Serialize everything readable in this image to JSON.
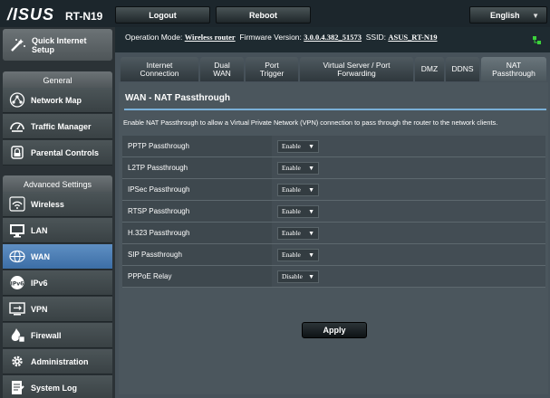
{
  "header": {
    "brand": "/ISUS",
    "model": "RT-N19",
    "logout_label": "Logout",
    "reboot_label": "Reboot",
    "language": "English"
  },
  "status_bar": {
    "operation_mode_label": "Operation Mode:",
    "operation_mode_value": "Wireless router",
    "firmware_label": "Firmware Version:",
    "firmware_value": "3.0.0.4.382_51573",
    "ssid_label": "SSID:",
    "ssid_value": "ASUS_RT-N19",
    "status_icon": "network-status-icon",
    "status_color": "#3bd13b"
  },
  "sidebar": {
    "quick_setup": {
      "label_line1": "Quick Internet",
      "label_line2": "Setup",
      "icon": "wand-icon"
    },
    "general_header": "General",
    "general_items": [
      {
        "label": "Network Map",
        "icon": "network-map-icon"
      },
      {
        "label": "Traffic Manager",
        "icon": "gauge-icon"
      },
      {
        "label": "Parental Controls",
        "icon": "lock-icon"
      }
    ],
    "advanced_header": "Advanced Settings",
    "advanced_items": [
      {
        "label": "Wireless",
        "icon": "wifi-icon"
      },
      {
        "label": "LAN",
        "icon": "monitor-icon"
      },
      {
        "label": "WAN",
        "icon": "globe-icon",
        "active": true
      },
      {
        "label": "IPv6",
        "icon": "ipv6-icon"
      },
      {
        "label": "VPN",
        "icon": "vpn-icon"
      },
      {
        "label": "Firewall",
        "icon": "firewall-icon"
      },
      {
        "label": "Administration",
        "icon": "gear-icon"
      },
      {
        "label": "System Log",
        "icon": "log-icon"
      }
    ]
  },
  "tabs": [
    {
      "line1": "Internet",
      "line2": "Connection"
    },
    {
      "line1": "Dual",
      "line2": "WAN"
    },
    {
      "line1": "Port",
      "line2": "Trigger"
    },
    {
      "line1": "Virtual Server / Port",
      "line2": "Forwarding"
    },
    {
      "line1": "DMZ",
      "line2": ""
    },
    {
      "line1": "DDNS",
      "line2": ""
    },
    {
      "line1": "NAT",
      "line2": "Passthrough",
      "active": true
    }
  ],
  "panel": {
    "title": "WAN - NAT Passthrough",
    "description": "Enable NAT Passthrough to allow a Virtual Private Network (VPN) connection to pass through the router to the network clients.",
    "rows": [
      {
        "label": "PPTP Passthrough",
        "value": "Enable"
      },
      {
        "label": "L2TP Passthrough",
        "value": "Enable"
      },
      {
        "label": "IPSec Passthrough",
        "value": "Enable"
      },
      {
        "label": "RTSP Passthrough",
        "value": "Enable"
      },
      {
        "label": "H.323 Passthrough",
        "value": "Enable"
      },
      {
        "label": "SIP Passthrough",
        "value": "Enable"
      },
      {
        "label": "PPPoE Relay",
        "value": "Disable"
      }
    ],
    "apply_label": "Apply"
  },
  "colors": {
    "accent_active": "#4f84bd",
    "divider": "#7ab0d8"
  }
}
